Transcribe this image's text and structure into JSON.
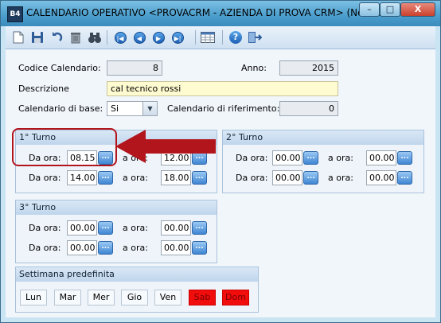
{
  "window": {
    "icon_text": "B4",
    "title": "CALENDARIO OPERATIVO <PROVACRM - AZIENDA DI PROVA CRM> (Non r...",
    "controls": {
      "minimize": "–",
      "maximize": "□",
      "close": "X"
    }
  },
  "toolbar": {
    "items": [
      "new-document",
      "save",
      "undo",
      "delete",
      "search",
      "first-record",
      "previous-record",
      "next-record",
      "last-record",
      "calendar-grid",
      "help",
      "exit"
    ]
  },
  "form": {
    "codice_label": "Codice Calendario:",
    "codice_value": "8",
    "anno_label": "Anno:",
    "anno_value": "2015",
    "descrizione_label": "Descrizione",
    "descrizione_value": "cal tecnico rossi",
    "base_label": "Calendario di base:",
    "base_value": "Si",
    "riferimento_label": "Calendario di riferimento:",
    "riferimento_value": "0"
  },
  "turni": [
    {
      "title": "1° Turno",
      "rows": [
        {
          "da_label": "Da ora:",
          "da": "08.15",
          "a_label": "a ora:",
          "a": "12.00"
        },
        {
          "da_label": "Da ora:",
          "da": "14.00",
          "a_label": "a ora:",
          "a": "18.00"
        }
      ]
    },
    {
      "title": "2° Turno",
      "rows": [
        {
          "da_label": "Da ora:",
          "da": "00.00",
          "a_label": "a ora:",
          "a": "00.00"
        },
        {
          "da_label": "Da ora:",
          "da": "00.00",
          "a_label": "a ora:",
          "a": "00.00"
        }
      ]
    },
    {
      "title": "3° Turno",
      "rows": [
        {
          "da_label": "Da ora:",
          "da": "00.00",
          "a_label": "a ora:",
          "a": "00.00"
        },
        {
          "da_label": "Da ora:",
          "da": "00.00",
          "a_label": "a ora:",
          "a": "00.00"
        }
      ]
    }
  ],
  "time_button_glyph": "...",
  "settimana": {
    "title": "Settimana predefinita",
    "days": [
      "Lun",
      "Mar",
      "Mer",
      "Gio",
      "Ven",
      "Sab",
      "Dom"
    ],
    "off_days": [
      "Sab",
      "Dom"
    ],
    "off_color": "#f20d0d"
  },
  "annotation": {
    "shape": "red-arrow",
    "color": "#b3151d"
  }
}
